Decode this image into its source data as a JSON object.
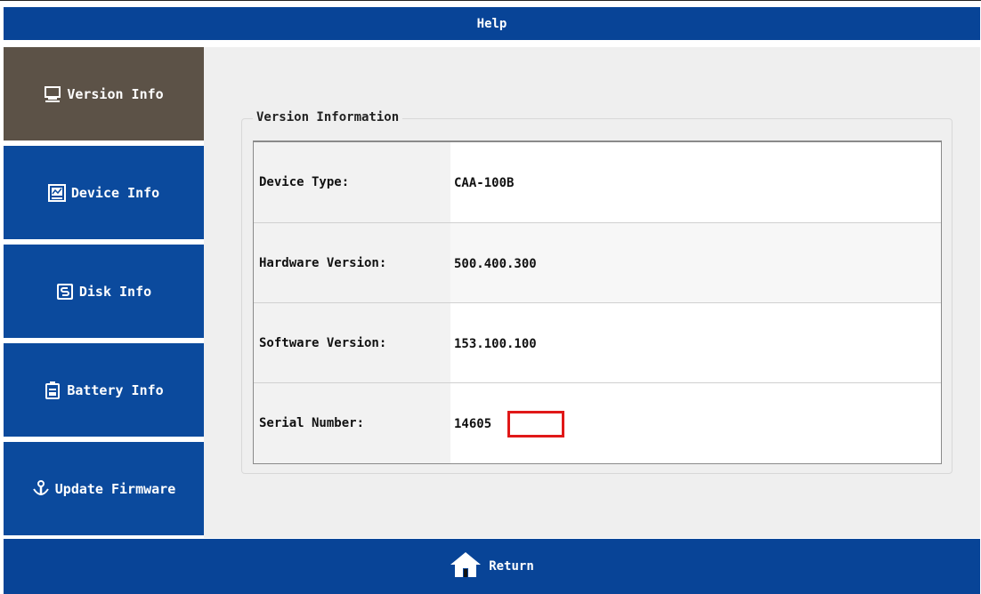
{
  "header": {
    "title": "Help"
  },
  "sidebar": {
    "items": [
      {
        "label": "Version Info",
        "icon": "computer-icon",
        "active": true
      },
      {
        "label": "Device Info",
        "icon": "monitor-icon",
        "active": false
      },
      {
        "label": "Disk Info",
        "icon": "disk-icon",
        "active": false
      },
      {
        "label": "Battery Info",
        "icon": "battery-icon",
        "active": false
      },
      {
        "label": "Update Firmware",
        "icon": "download-icon",
        "active": false
      }
    ]
  },
  "main": {
    "group_title": "Version Information",
    "rows": [
      {
        "label": "Device Type:",
        "value": "CAA-100B"
      },
      {
        "label": "Hardware Version:",
        "value": "500.400.300"
      },
      {
        "label": "Software Version:",
        "value": "153.100.100"
      },
      {
        "label": "Serial Number:",
        "value": "14605"
      }
    ]
  },
  "footer": {
    "return_label": "Return",
    "icon": "home-icon"
  },
  "colors": {
    "header": "#084497",
    "sidebar": "#0b4a9d",
    "sidebar_active": "#5c5247",
    "highlight": "#e01818"
  }
}
